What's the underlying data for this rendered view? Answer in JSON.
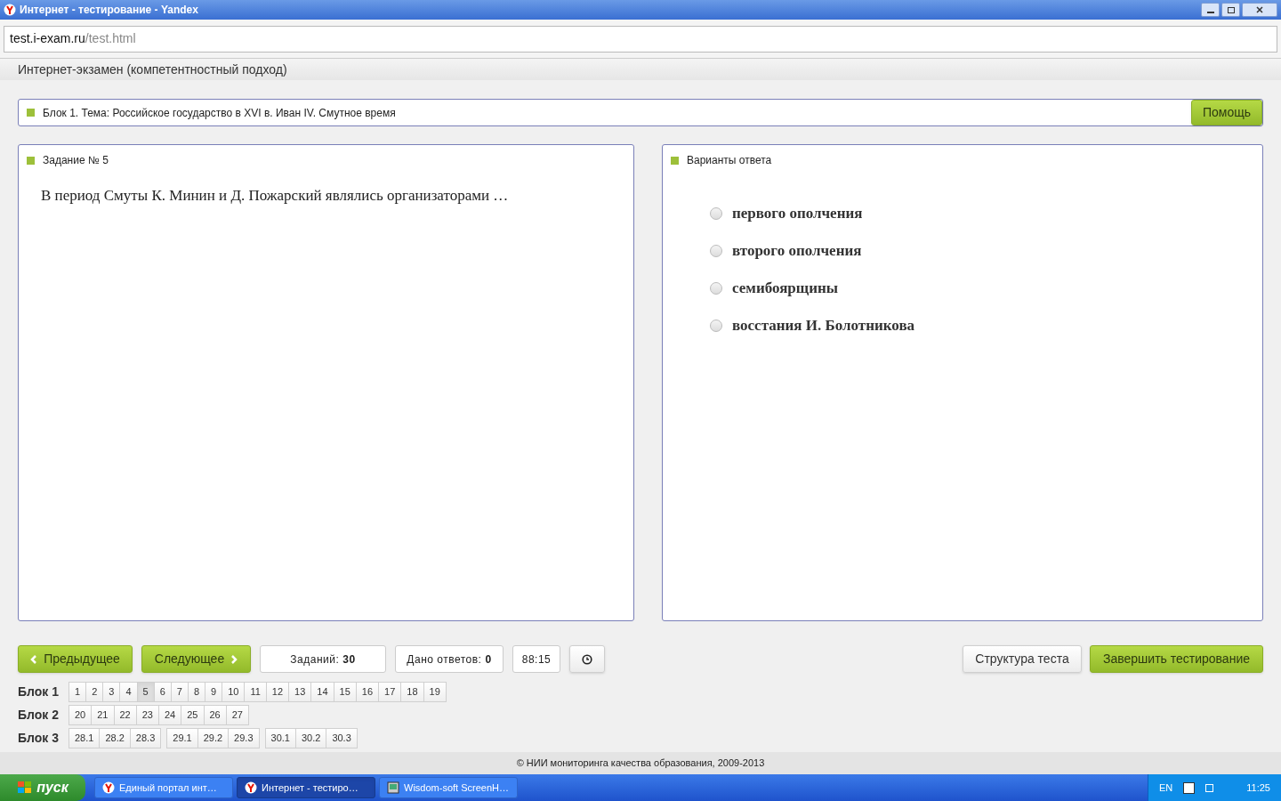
{
  "window": {
    "title": "Интернет - тестирование - Yandex"
  },
  "address_bar": {
    "host": "test.i-exam.ru",
    "path": "/test.html"
  },
  "app_header": {
    "title": "Интернет-экзамен (компетентностный подход)"
  },
  "topic_bar": {
    "text": "Блок 1. Тема: Российское государство в XVI в. Иван IV. Смутное время",
    "help_button": "Помощь"
  },
  "task_panel": {
    "title": "Задание № 5",
    "question": "В период Смуты К. Минин и Д. Пожарский являлись организаторами …"
  },
  "answers_panel": {
    "title": "Варианты ответа",
    "options": [
      {
        "label": "первого ополчения",
        "selected": false
      },
      {
        "label": "второго ополчения",
        "selected": false
      },
      {
        "label": "семибоярщины",
        "selected": false
      },
      {
        "label": "восстания И. Болотникова",
        "selected": false
      }
    ]
  },
  "nav": {
    "prev": "Предыдущее",
    "next": "Следующее",
    "tasks_label": "Заданий:",
    "tasks_count": "30",
    "answered_label": "Дано ответов:",
    "answered_count": "0",
    "timer": "88:15",
    "structure": "Структура теста",
    "finish": "Завершить тестирование"
  },
  "blocks": [
    {
      "label": "Блок 1",
      "groups": [
        [
          {
            "label": "1",
            "selected": false
          },
          {
            "label": "2",
            "selected": false
          },
          {
            "label": "3",
            "selected": false
          },
          {
            "label": "4",
            "selected": false
          },
          {
            "label": "5",
            "selected": true
          },
          {
            "label": "6",
            "selected": false
          },
          {
            "label": "7",
            "selected": false
          },
          {
            "label": "8",
            "selected": false
          },
          {
            "label": "9",
            "selected": false
          },
          {
            "label": "10",
            "selected": false
          },
          {
            "label": "11",
            "selected": false
          },
          {
            "label": "12",
            "selected": false
          },
          {
            "label": "13",
            "selected": false
          },
          {
            "label": "14",
            "selected": false
          },
          {
            "label": "15",
            "selected": false
          },
          {
            "label": "16",
            "selected": false
          },
          {
            "label": "17",
            "selected": false
          },
          {
            "label": "18",
            "selected": false
          },
          {
            "label": "19",
            "selected": false
          }
        ]
      ]
    },
    {
      "label": "Блок 2",
      "groups": [
        [
          {
            "label": "20",
            "selected": false
          },
          {
            "label": "21",
            "selected": false
          },
          {
            "label": "22",
            "selected": false
          },
          {
            "label": "23",
            "selected": false
          },
          {
            "label": "24",
            "selected": false
          },
          {
            "label": "25",
            "selected": false
          },
          {
            "label": "26",
            "selected": false
          },
          {
            "label": "27",
            "selected": false
          }
        ]
      ]
    },
    {
      "label": "Блок 3",
      "groups": [
        [
          {
            "label": "28.1",
            "selected": false
          },
          {
            "label": "28.2",
            "selected": false
          },
          {
            "label": "28.3",
            "selected": false
          }
        ],
        [
          {
            "label": "29.1",
            "selected": false
          },
          {
            "label": "29.2",
            "selected": false
          },
          {
            "label": "29.3",
            "selected": false
          }
        ],
        [
          {
            "label": "30.1",
            "selected": false
          },
          {
            "label": "30.2",
            "selected": false
          },
          {
            "label": "30.3",
            "selected": false
          }
        ]
      ]
    }
  ],
  "footer": {
    "text": "© НИИ мониторинга качества образования, 2009-2013"
  },
  "taskbar": {
    "start": "пуск",
    "tasks": [
      {
        "label": "Единый портал инт…",
        "selected": false,
        "kind": "browser"
      },
      {
        "label": "Интернет - тестиро…",
        "selected": true,
        "kind": "browser"
      },
      {
        "label": "Wisdom-soft ScreenH…",
        "selected": false,
        "kind": "app"
      }
    ],
    "language": "EN",
    "clock": "11:25"
  }
}
